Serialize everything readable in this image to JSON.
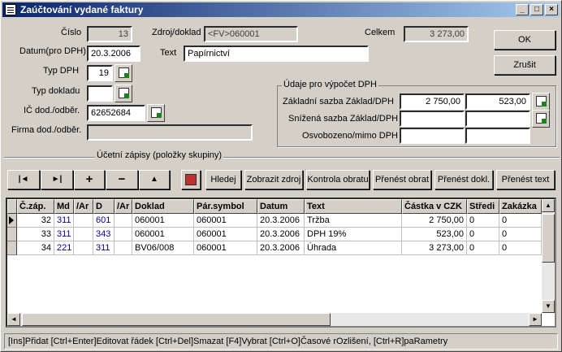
{
  "window": {
    "title": "Zaúčtování vydané faktury",
    "controls": [
      "_",
      "□",
      "×"
    ]
  },
  "header": {
    "cislo_label": "Číslo",
    "cislo_value": "13",
    "datum_label": "Datum(pro DPH)",
    "datum_value": "20.3.2006",
    "typdph_label": "Typ DPH",
    "typdph_value": "19",
    "typdokladu_label": "Typ dokladu",
    "typdokladu_value": "",
    "ic_label": "IČ dod./odběr.",
    "ic_value": "62652684",
    "firma_label": "Firma dod./odběr.",
    "firma_value": "",
    "zdroj_label": "Zdroj/doklad",
    "zdroj_value": "<FV>060001",
    "text_label": "Text",
    "text_value": "Papírnictví",
    "celkem_label": "Celkem",
    "celkem_value": "3 273,00"
  },
  "buttons": {
    "ok": "OK",
    "zrusit": "Zrušit"
  },
  "dph": {
    "group_title": "Údaje pro výpočet DPH",
    "zakladni_label": "Základní sazba  Základ/DPH",
    "zakladni_zaklad": "2 750,00",
    "zakladni_dph": "523,00",
    "snizena_label": "Snížená sazba Základ/DPH",
    "snizena_zaklad": "",
    "snizena_dph": "",
    "osvobozeno_label": "Osvobozeno/mimo DPH",
    "osvobozeno_zaklad": "",
    "osvobozeno_dph": ""
  },
  "zapisy": {
    "title": "Účetní zápisy (položky skupiny)",
    "nav": [
      "|◄",
      "►|",
      "+",
      "−",
      "▲"
    ],
    "hledej": "Hledej",
    "zobrazit_zdroj": "Zobrazit zdroj",
    "kontrola_obratu": "Kontrola obratu",
    "prenest_obrat": "Přenést obrat",
    "prenest_dokl": "Přenést dokl.",
    "prenest_text": "Přenést text"
  },
  "grid": {
    "columns": [
      "Č.záp.",
      "Md",
      "/Ar",
      "D",
      "/Ar",
      "Doklad",
      "Pár.symbol",
      "Datum",
      "Text",
      "Částka v CZK",
      "Středi",
      "Zakázka"
    ],
    "rows": [
      {
        "zap": "32",
        "md": "311",
        "ar1": "",
        "d": "601",
        "ar2": "",
        "doklad": "060001",
        "par": "060001",
        "datum": "20.3.2006",
        "text": "Tržba",
        "castka": "2 750,00",
        "stred": "0",
        "zakazka": "0"
      },
      {
        "zap": "33",
        "md": "311",
        "ar1": "",
        "d": "343",
        "ar2": "",
        "doklad": "060001",
        "par": "060001",
        "datum": "20.3.2006",
        "text": "DPH 19%",
        "castka": "523,00",
        "stred": "0",
        "zakazka": "0"
      },
      {
        "zap": "34",
        "md": "221",
        "ar1": "",
        "d": "311",
        "ar2": "",
        "doklad": "BV06/008",
        "par": "060001",
        "datum": "20.3.2006",
        "text": "Úhrada",
        "castka": "3 273,00",
        "stred": "0",
        "zakazka": "0"
      }
    ]
  },
  "status": "[Ins]Přidat [Ctrl+Enter]Editovat řádek [Ctrl+Del]Smazat [F4]Vybrat [Ctrl+O]Časové rOzlišení, [Ctrl+R]paRametry"
}
